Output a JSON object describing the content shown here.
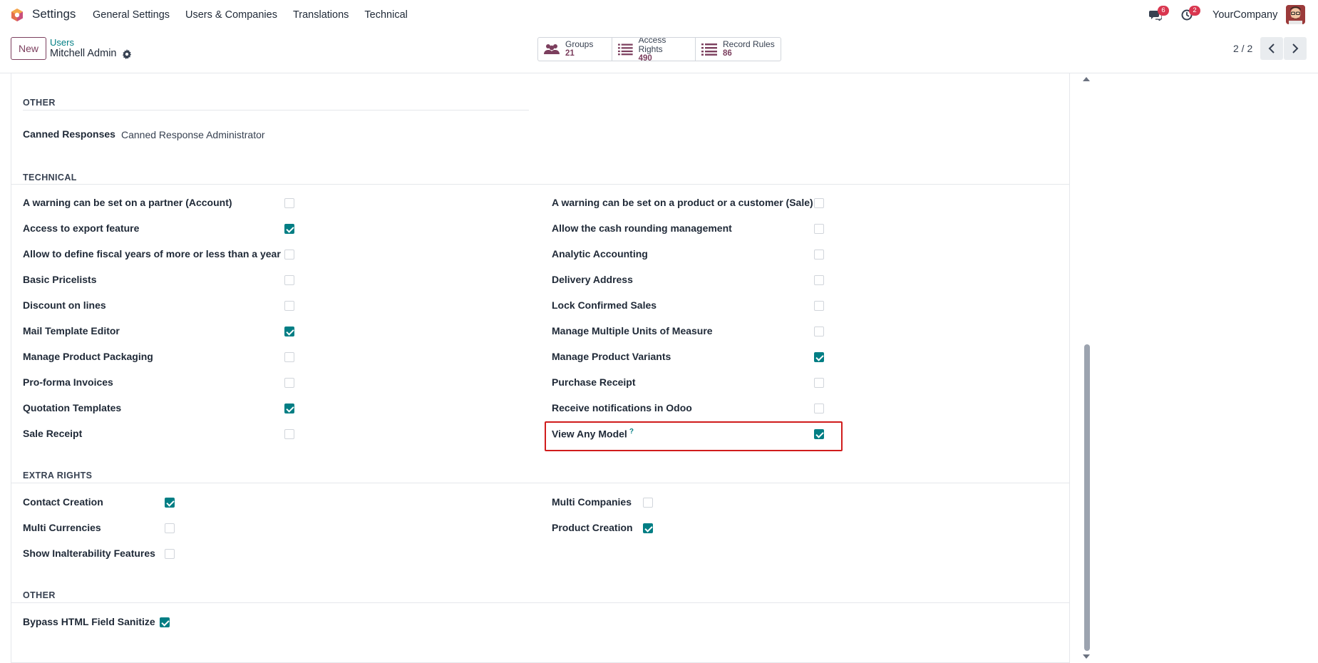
{
  "nav": {
    "app_title": "Settings",
    "menu": [
      "General Settings",
      "Users & Companies",
      "Translations",
      "Technical"
    ],
    "messages_badge": "6",
    "activity_badge": "2",
    "company": "YourCompany"
  },
  "control_panel": {
    "new_label": "New",
    "breadcrumb_parent": "Users",
    "breadcrumb_current": "Mitchell Admin",
    "stats": [
      {
        "label": "Groups",
        "value": "21"
      },
      {
        "label": "Access Rights",
        "value": "490"
      },
      {
        "label": "Record Rules",
        "value": "86"
      }
    ],
    "pager": "2 / 2"
  },
  "sections": {
    "other_top": {
      "title": "OTHER",
      "canned_label": "Canned Responses",
      "canned_value": "Canned Response Administrator"
    },
    "technical": {
      "title": "TECHNICAL",
      "left": [
        {
          "label": "A warning can be set on a partner (Account)",
          "checked": false
        },
        {
          "label": "Access to export feature",
          "checked": true
        },
        {
          "label": "Allow to define fiscal years of more or less than a year",
          "checked": false
        },
        {
          "label": "Basic Pricelists",
          "checked": false
        },
        {
          "label": "Discount on lines",
          "checked": false
        },
        {
          "label": "Mail Template Editor",
          "checked": true
        },
        {
          "label": "Manage Product Packaging",
          "checked": false
        },
        {
          "label": "Pro-forma Invoices",
          "checked": false
        },
        {
          "label": "Quotation Templates",
          "checked": true
        },
        {
          "label": "Sale Receipt",
          "checked": false
        }
      ],
      "right": [
        {
          "label": "A warning can be set on a product or a customer (Sale)",
          "checked": false
        },
        {
          "label": "Allow the cash rounding management",
          "checked": false
        },
        {
          "label": "Analytic Accounting",
          "checked": false
        },
        {
          "label": "Delivery Address",
          "checked": false
        },
        {
          "label": "Lock Confirmed Sales",
          "checked": false
        },
        {
          "label": "Manage Multiple Units of Measure",
          "checked": false
        },
        {
          "label": "Manage Product Variants",
          "checked": true
        },
        {
          "label": "Purchase Receipt",
          "checked": false
        },
        {
          "label": "Receive notifications in Odoo",
          "checked": false
        },
        {
          "label": "View Any Model",
          "checked": true,
          "help": "?"
        }
      ]
    },
    "extra_rights": {
      "title": "EXTRA RIGHTS",
      "left": [
        {
          "label": "Contact Creation",
          "checked": true
        },
        {
          "label": "Multi Currencies",
          "checked": false
        },
        {
          "label": "Show Inalterability Features",
          "checked": false
        }
      ],
      "right": [
        {
          "label": "Multi Companies",
          "checked": false
        },
        {
          "label": "Product Creation",
          "checked": true
        }
      ]
    },
    "other_bottom": {
      "title": "OTHER",
      "items": [
        {
          "label": "Bypass HTML Field Sanitize",
          "checked": true
        }
      ]
    }
  },
  "colors": {
    "accent": "#017e84",
    "brand": "#7c3f5e",
    "badge": "#d9364f",
    "highlight": "#d01c1c"
  }
}
